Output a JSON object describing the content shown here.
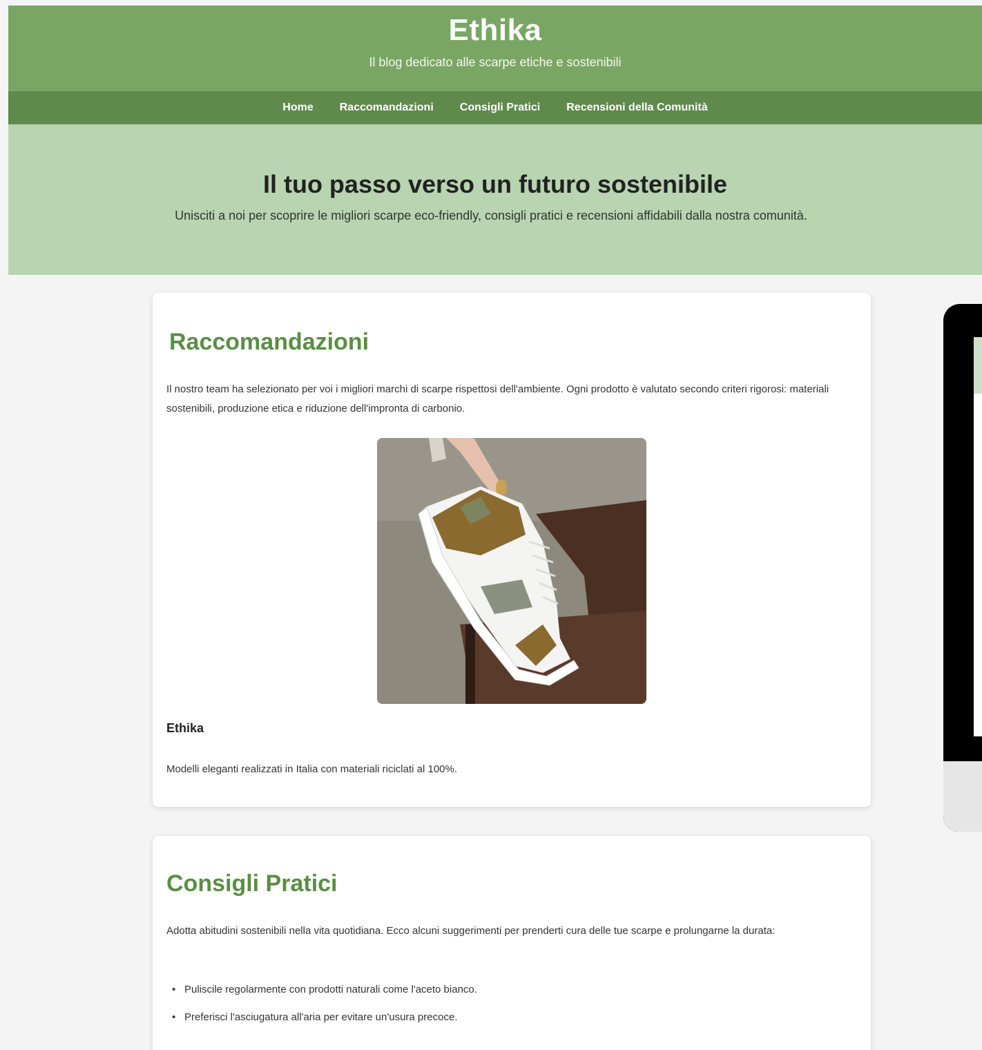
{
  "header": {
    "title": "Ethika",
    "tagline": "Il blog dedicato alle scarpe etiche e sostenibili"
  },
  "nav": {
    "items": [
      {
        "label": "Home"
      },
      {
        "label": "Raccomandazioni"
      },
      {
        "label": "Consigli Pratici"
      },
      {
        "label": "Recensioni della Comunità"
      }
    ]
  },
  "hero": {
    "title": "Il tuo passo verso un futuro sostenibile",
    "subtitle": "Unisciti a noi per scoprire le migliori scarpe eco-friendly, consigli pratici e recensioni affidabili dalla nostra comunità."
  },
  "recommendations": {
    "title": "Raccomandazioni",
    "intro": "Il nostro team ha selezionato per voi i migliori marchi di scarpe rispettosi dell'ambiente. Ogni prodotto è valutato secondo criteri rigorosi: materiali sostenibili, produzione etica e riduzione dell'impronta di carbonio.",
    "product": {
      "name": "Ethika",
      "description": "Modelli eleganti realizzati in Italia con materiali riciclati al 100%."
    }
  },
  "tips": {
    "title": "Consigli Pratici",
    "intro": "Adotta abitudini sostenibili nella vita quotidiana. Ecco alcuni suggerimenti per prenderti cura delle tue scarpe e prolungarne la durata:",
    "items": [
      "Puliscile regolarmente con prodotti naturali come l'aceto bianco.",
      "Preferisci l'asciugatura all'aria per evitare un'usura precoce."
    ]
  },
  "colors": {
    "header": "#7aa663",
    "nav": "#5f8a4b",
    "hero": "#b8d4b1",
    "accent": "#5a8e44"
  }
}
